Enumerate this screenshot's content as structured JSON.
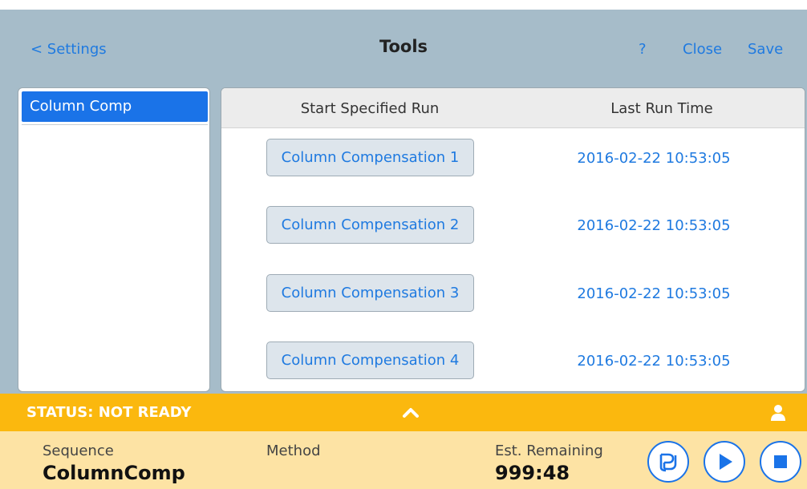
{
  "header": {
    "back_label": "< Settings",
    "title": "Tools",
    "help_label": "?",
    "close_label": "Close",
    "save_label": "Save"
  },
  "sidebar": {
    "items": [
      {
        "label": "Column Comp",
        "selected": true
      }
    ]
  },
  "table": {
    "columns": [
      "Start Specified Run",
      "Last Run Time"
    ],
    "rows": [
      {
        "button": "Column Compensation 1",
        "time": "2016-02-22 10:53:05"
      },
      {
        "button": "Column Compensation 2",
        "time": "2016-02-22 10:53:05"
      },
      {
        "button": "Column Compensation 3",
        "time": "2016-02-22 10:53:05"
      },
      {
        "button": "Column Compensation 4",
        "time": "2016-02-22 10:53:05"
      }
    ]
  },
  "status": {
    "text": "STATUS: NOT READY",
    "expand_icon": "chevron-up-icon",
    "user_icon": "user-icon"
  },
  "info": {
    "sequence_label": "Sequence",
    "sequence_value": "ColumnComp",
    "method_label": "Method",
    "remaining_label": "Est. Remaining",
    "remaining_value": "999:48"
  },
  "controls": {
    "prep_icon": "prep-icon",
    "run_icon": "play-icon",
    "stop_icon": "stop-icon"
  },
  "colors": {
    "accent": "#1a73e8",
    "link": "#1f7ae0",
    "background": "#a6bcc9",
    "status_bar": "#fbb80e",
    "info_bar": "#fde3a4"
  }
}
